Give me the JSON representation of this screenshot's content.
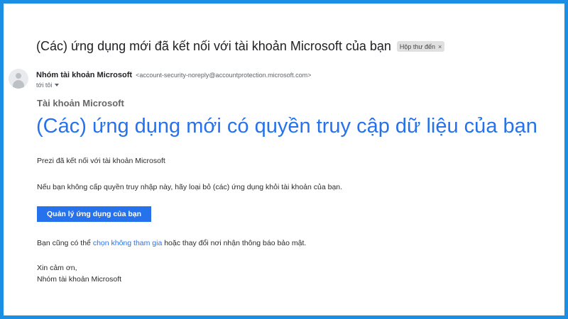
{
  "email": {
    "subject": "(Các) ứng dụng mới đã kết nối với tài khoản Microsoft của bạn",
    "label_chip": "Hộp thư đến",
    "label_close": "×",
    "sender_name": "Nhóm tài khoản Microsoft",
    "sender_email": "<account-security-noreply@accountprotection.microsoft.com>",
    "to_text": "tới tôi"
  },
  "body": {
    "account_label": "Tài khoản Microsoft",
    "headline": "(Các) ứng dụng mới có quyền truy cập dữ liệu của bạn",
    "connected_text": "Prezi đã kết nối với tài khoản Microsoft",
    "remove_text": "Nếu bạn không cấp quyền truy nhập này, hãy loại bỏ (các) ứng dụng khỏi tài khoản của bạn.",
    "manage_button": "Quản lý ứng dụng của bạn",
    "optout_prefix": "Bạn cũng có thể ",
    "optout_link": "chọn không tham gia",
    "optout_suffix": " hoặc thay đổi nơi nhận thông báo bảo mật.",
    "signoff": "Xin cảm ơn,",
    "signature": "Nhóm tài khoản Microsoft"
  },
  "colors": {
    "frame_border": "#1a8fe3",
    "accent": "#2672ec"
  },
  "icons": {
    "avatar": "default-person-avatar",
    "to_menu": "caret-down-icon",
    "label_remove": "close-icon"
  }
}
